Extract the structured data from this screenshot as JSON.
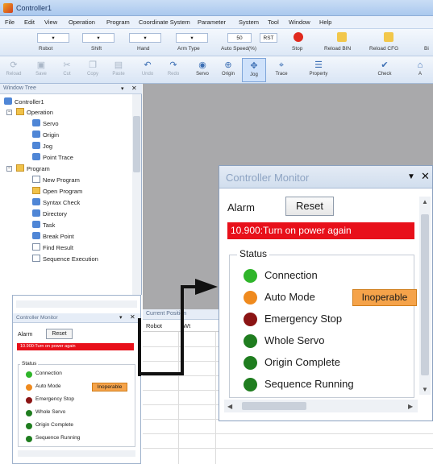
{
  "window": {
    "title": "Controller1"
  },
  "menu": [
    "File",
    "Edit",
    "View",
    "Operation",
    "Program",
    "Coordinate System",
    "Parameter",
    "System",
    "Tool",
    "Window",
    "Help"
  ],
  "ribbon": {
    "robot_label": "Robot",
    "shift_label": "Shift",
    "hand_label": "Hand",
    "arm_type_label": "Arm Type",
    "auto_speed_label": "Auto Speed(%)",
    "auto_speed_value": "50",
    "stop_label": "Stop",
    "reload_bin_label": "Reload BIN",
    "reload_cfg_label": "Reload CFG",
    "extra_label": "Bi",
    "rst_value": "RST"
  },
  "toolbar": [
    "Reload",
    "Save",
    "Cut",
    "Copy",
    "Paste",
    "Undo",
    "Redo",
    "Servo",
    "Origin",
    "Jog",
    "Trace",
    "Property",
    "Check",
    "A"
  ],
  "tree": {
    "title": "Window Tree",
    "root": "Controller1",
    "operation": "Operation",
    "operation_items": [
      "Servo",
      "Origin",
      "Jog",
      "Point Trace"
    ],
    "program": "Program",
    "program_items": [
      "New Program",
      "Open Program",
      "Syntax Check",
      "Directory",
      "Task",
      "Break Point",
      "Find Result",
      "Sequence Execution"
    ]
  },
  "current_position": {
    "title": "Current Position",
    "col1": "Robot",
    "col2": "Wt"
  },
  "monitor": {
    "title": "Controller Monitor",
    "alarm_label": "Alarm",
    "reset_label": "Reset",
    "error_message": "10.900:Turn on power again",
    "status_label": "Status",
    "items": [
      {
        "label": "Connection",
        "color": "#2fb52a"
      },
      {
        "label": "Auto Mode",
        "color": "#ef8a1e",
        "badge": "Inoperable"
      },
      {
        "label": "Emergency Stop",
        "color": "#8b1414"
      },
      {
        "label": "Whole Servo",
        "color": "#1f7d1f"
      },
      {
        "label": "Origin Complete",
        "color": "#1f7d1f"
      },
      {
        "label": "Sequence Running",
        "color": "#1f7d1f"
      }
    ],
    "badge_color": "#f5a34a",
    "error_color": "#e8101a"
  }
}
